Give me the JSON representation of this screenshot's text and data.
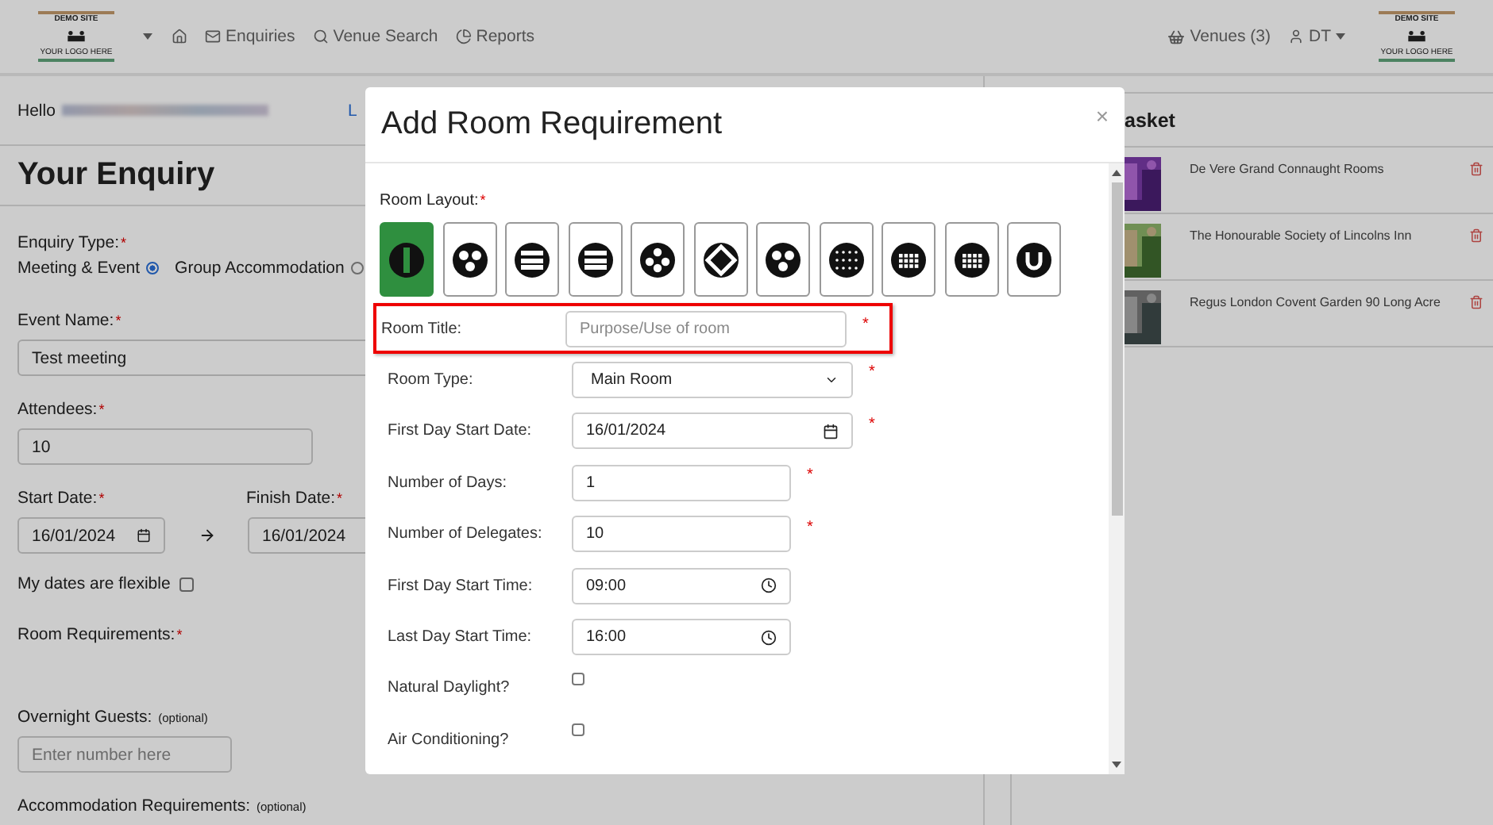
{
  "navbar": {
    "logos": [
      {
        "title": "DEMO SITE",
        "subtitle": "YOUR LOGO HERE"
      },
      {
        "title": "DEMO SITE",
        "subtitle": "YOUR LOGO HERE"
      }
    ],
    "links": [
      {
        "kind": "home"
      },
      {
        "kind": "mail",
        "label": "Enquiries"
      },
      {
        "kind": "search",
        "label": "Venue Search"
      },
      {
        "kind": "pie",
        "label": "Reports"
      }
    ],
    "basket": "Venues (3)",
    "user": "DT"
  },
  "greeting": {
    "hello": "Hello",
    "cut": "L"
  },
  "heading": "Your Enquiry",
  "enquiry_form": {
    "enquiry_type": {
      "label": "Enquiry Type:",
      "mark": "*",
      "options": [
        {
          "label": "Meeting & Event",
          "selected": true
        },
        {
          "label": "Group Accommodation",
          "selected": false
        }
      ]
    },
    "event_name": {
      "label": "Event Name:",
      "mark": "*",
      "value": "Test meeting"
    },
    "attendees": {
      "label": "Attendees:",
      "mark": "*",
      "value": "10"
    },
    "start_date": {
      "label": "Start Date:",
      "mark": "*",
      "value": "16/01/2024"
    },
    "finish_date": {
      "label": "Finish Date:",
      "mark": "*",
      "value": "16/01/2024"
    },
    "flexible": {
      "label": "My dates are flexible",
      "checked": false
    },
    "room_requirements": {
      "label": "Room Requirements:",
      "mark": "*"
    },
    "overnight": {
      "label": "Overnight Guests:",
      "note": "(optional)",
      "placeholder": "Enter number here"
    },
    "accommodation": {
      "label": "Accommodation Requirements:",
      "note": "(optional)"
    }
  },
  "basket": {
    "title": "asket",
    "items": [
      {
        "name": "De Vere Grand Connaught Rooms",
        "kind": "picture"
      },
      {
        "name": "The Honourable Society of Lincolns Inn",
        "kind": "picture"
      },
      {
        "name": "Regus London Covent Garden 90 Long Acre",
        "kind": "picture"
      }
    ]
  },
  "modal": {
    "title": "Add Room Requirement",
    "close": "×",
    "layout_label": "Room Layout:",
    "layout_mark": "*",
    "layouts": [
      {
        "selected": true
      },
      {
        "selected": false
      },
      {
        "selected": false
      },
      {
        "selected": false
      },
      {
        "selected": false
      },
      {
        "selected": false
      },
      {
        "selected": false
      },
      {
        "selected": false
      },
      {
        "selected": false
      },
      {
        "selected": false
      },
      {
        "selected": false
      }
    ],
    "fields": [
      {
        "kind": "text",
        "label": "Room Title:",
        "placeholder": "Purpose/Use of room",
        "mark": "*",
        "highlighted": true
      },
      {
        "kind": "select",
        "label": "Room Type:",
        "value": "Main Room",
        "mark": "*"
      },
      {
        "kind": "date",
        "label": "First Day Start Date:",
        "value": "16/01/2024",
        "mark": "*"
      },
      {
        "kind": "number",
        "label": "Number of Days:",
        "value": "1",
        "mark": "*"
      },
      {
        "kind": "number",
        "label": "Number of Delegates:",
        "value": "10",
        "mark": "*"
      },
      {
        "kind": "time",
        "label": "First Day Start Time:",
        "value": "09:00"
      },
      {
        "kind": "time",
        "label": "Last Day Start Time:",
        "value": "16:00"
      },
      {
        "kind": "checkbox",
        "label": "Natural Daylight?",
        "checked": false
      },
      {
        "kind": "checkbox",
        "label": "Air Conditioning?",
        "checked": false
      }
    ]
  }
}
